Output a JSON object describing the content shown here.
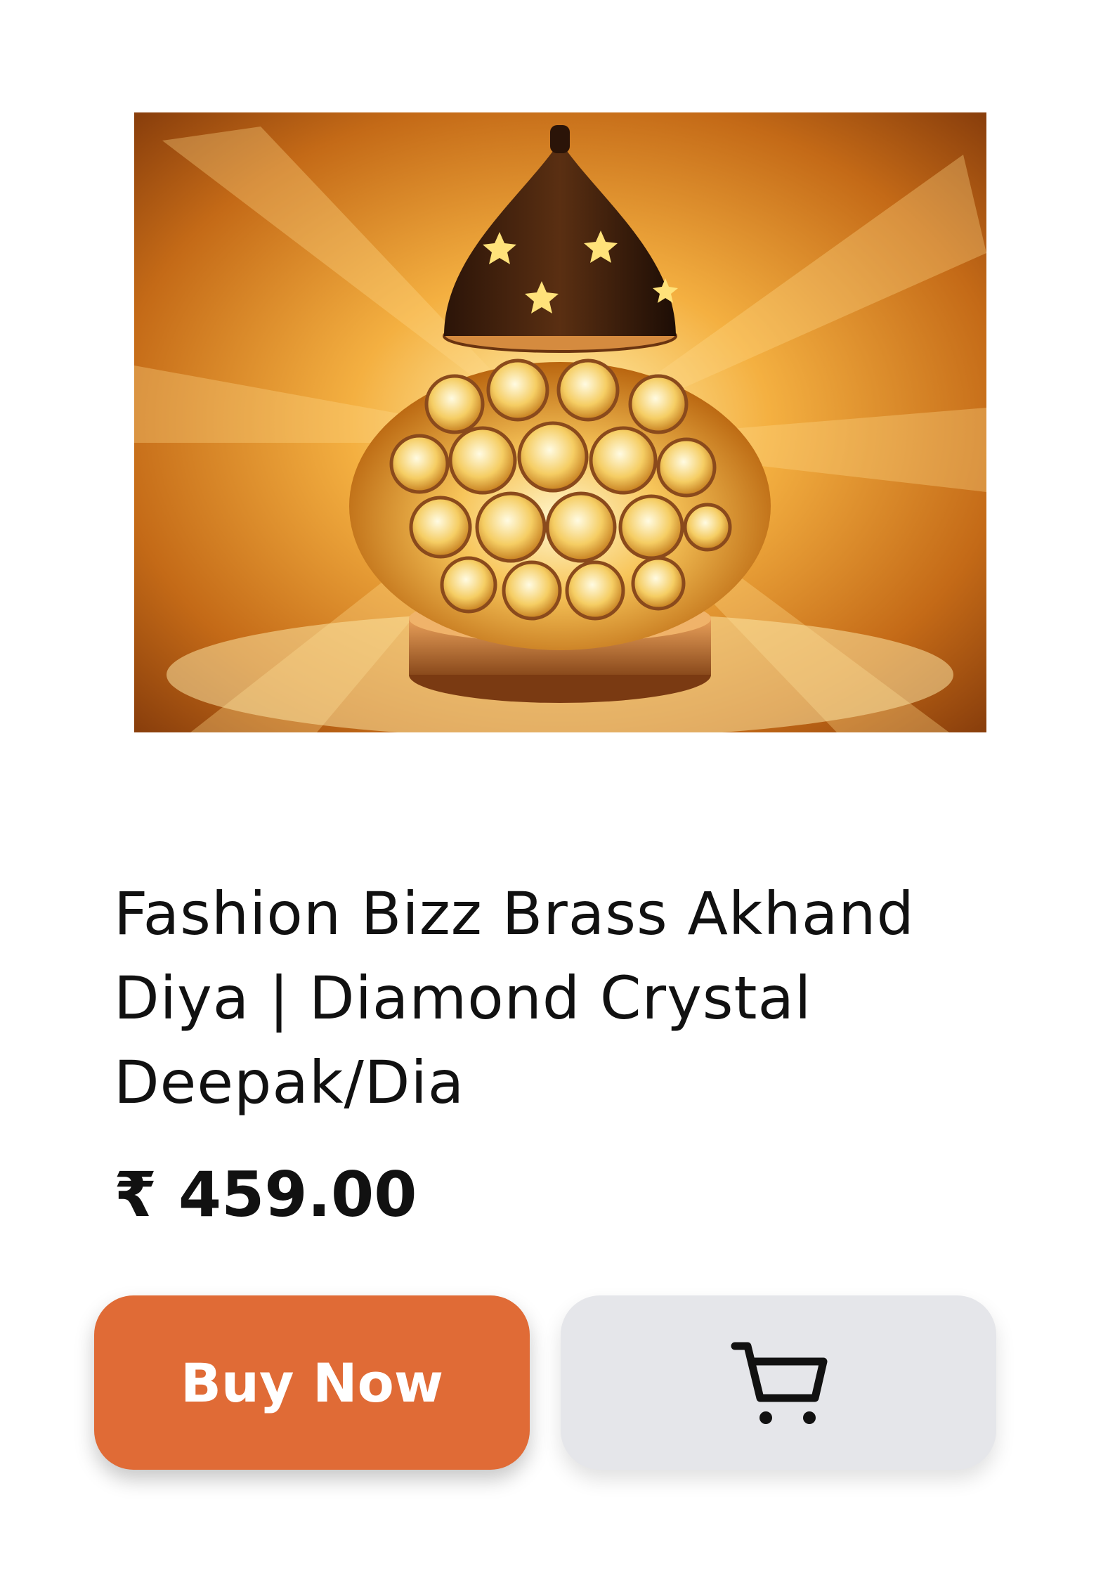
{
  "product": {
    "image_alt": "Brass crystal akhand diya lamp",
    "title": "Fashion Bizz Brass Akhand Diya | Diamond Crystal Deepak/Dia",
    "price": "₹ 459.00"
  },
  "actions": {
    "buy_label": "Buy Now",
    "cart_icon": "cart-icon"
  },
  "colors": {
    "buy_button": "#e06b36",
    "cart_button": "#e5e6ea",
    "text": "#111111"
  }
}
